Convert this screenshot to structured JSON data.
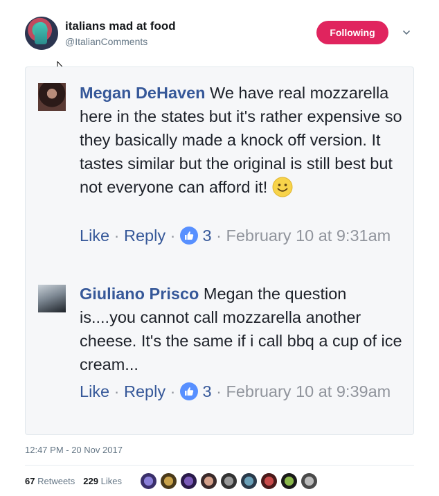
{
  "account": {
    "display_name": "italians mad at food",
    "handle": "@ItalianComments",
    "follow_label": "Following"
  },
  "comments": [
    {
      "author": "Megan DeHaven",
      "text": " We have real mozzarella here in the states but it's rather expensive so they basically made a knock off version. It tastes similar but the original is still best but not everyone can afford it! ",
      "like_label": "Like",
      "reply_label": "Reply",
      "reaction_count": "3",
      "date": "February 10 at 9:31am"
    },
    {
      "author": "Giuliano Prisco",
      "text": " Megan the question is....you cannot call mozzarella another cheese. It's the same if i call bbq a cup of ice cream...",
      "like_label": "Like",
      "reply_label": "Reply",
      "reaction_count": "3",
      "date": "February 10 at 9:39am"
    }
  ],
  "footer": {
    "timestamp": "12:47 PM - 20 Nov 2017",
    "retweets_count": "67",
    "retweets_label": "Retweets",
    "likes_count": "229",
    "likes_label": "Likes"
  },
  "colors": {
    "follow_button": "#e0245e",
    "commenter_name": "#365899",
    "like_badge": "#5890ff",
    "meta_text": "#657786"
  },
  "icons": {
    "caret": "chevron-down-icon",
    "reaction": "thumbs-up-icon",
    "emoji": "smiley-emoji-icon"
  }
}
